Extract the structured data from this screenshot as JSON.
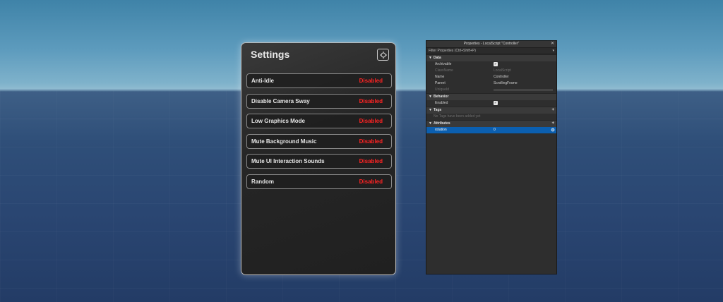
{
  "settings": {
    "title": "Settings",
    "options": [
      {
        "label": "Anti-Idle",
        "status": "Disabled"
      },
      {
        "label": "Disable Camera Sway",
        "status": "Disabled"
      },
      {
        "label": "Low Graphics Mode",
        "status": "Disabled"
      },
      {
        "label": "Mute Background Music",
        "status": "Disabled"
      },
      {
        "label": "Mute UI Interaction Sounds",
        "status": "Disabled"
      },
      {
        "label": "Random",
        "status": "Disabled"
      }
    ],
    "status_color": "#ff2323"
  },
  "properties": {
    "title": "Properties - LocalScript \"Controller\"",
    "filter_placeholder": "Filter Properties (Ctrl+Shift+P)",
    "sections": {
      "data": "Data",
      "behavior": "Behavior",
      "tags": "Tags",
      "attributes": "Attributes"
    },
    "data_rows": {
      "archivable": "Archivable",
      "classname_key": "ClassName",
      "classname_val": "LocalScript",
      "name_key": "Name",
      "name_val": "Controller",
      "parent_key": "Parent",
      "parent_val": "ScrollingFrame",
      "uniqueid_key": "UniqueId"
    },
    "behavior_rows": {
      "enabled": "Enabled"
    },
    "tags_note": "No Tags have been added yet",
    "attribute": {
      "key": "rotation",
      "value": "0"
    },
    "selection_color": "#0b5fb0"
  }
}
